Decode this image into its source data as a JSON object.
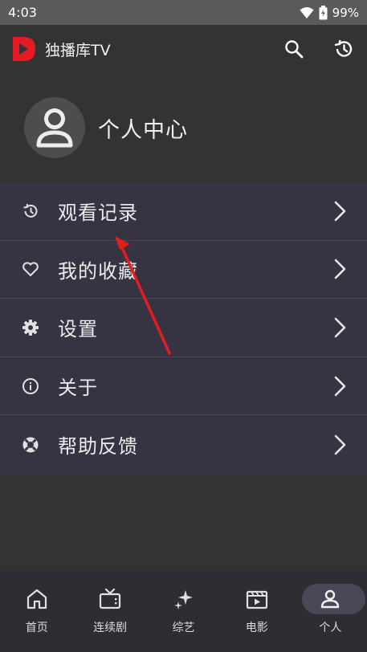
{
  "status_bar": {
    "time": "4:03",
    "battery": "99%"
  },
  "app_bar": {
    "title": "独播库TV",
    "logo_color": "#e31b23"
  },
  "profile": {
    "title": "个人中心"
  },
  "menu": {
    "items": [
      {
        "label": "观看记录",
        "icon": "history-icon"
      },
      {
        "label": "我的收藏",
        "icon": "heart-icon"
      },
      {
        "label": "设置",
        "icon": "gear-icon"
      },
      {
        "label": "关于",
        "icon": "info-icon"
      },
      {
        "label": "帮助反馈",
        "icon": "lifebuoy-icon"
      }
    ]
  },
  "bottom_nav": {
    "items": [
      {
        "label": "首页",
        "icon": "home-icon"
      },
      {
        "label": "连续剧",
        "icon": "tv-icon"
      },
      {
        "label": "综艺",
        "icon": "sparkle-icon"
      },
      {
        "label": "电影",
        "icon": "clapperboard-icon"
      },
      {
        "label": "个人",
        "icon": "person-icon",
        "active": true
      }
    ]
  },
  "colors": {
    "background": "#333333",
    "menu_background": "#383343",
    "annotation_arrow": "#e01e1e"
  }
}
